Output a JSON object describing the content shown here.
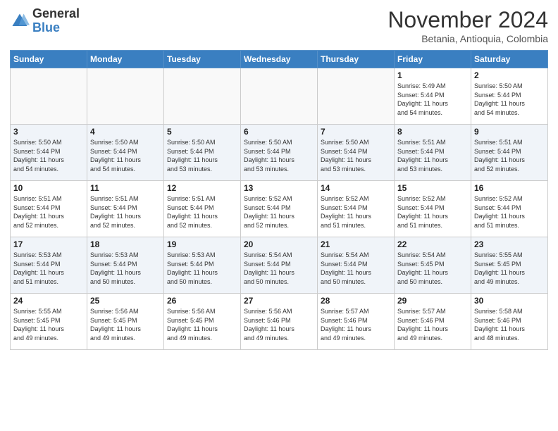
{
  "header": {
    "logo": {
      "general": "General",
      "blue": "Blue"
    },
    "title": "November 2024",
    "location": "Betania, Antioquia, Colombia"
  },
  "days_of_week": [
    "Sunday",
    "Monday",
    "Tuesday",
    "Wednesday",
    "Thursday",
    "Friday",
    "Saturday"
  ],
  "weeks": [
    [
      {
        "day": "",
        "info": ""
      },
      {
        "day": "",
        "info": ""
      },
      {
        "day": "",
        "info": ""
      },
      {
        "day": "",
        "info": ""
      },
      {
        "day": "",
        "info": ""
      },
      {
        "day": "1",
        "info": "Sunrise: 5:49 AM\nSunset: 5:44 PM\nDaylight: 11 hours\nand 54 minutes."
      },
      {
        "day": "2",
        "info": "Sunrise: 5:50 AM\nSunset: 5:44 PM\nDaylight: 11 hours\nand 54 minutes."
      }
    ],
    [
      {
        "day": "3",
        "info": "Sunrise: 5:50 AM\nSunset: 5:44 PM\nDaylight: 11 hours\nand 54 minutes."
      },
      {
        "day": "4",
        "info": "Sunrise: 5:50 AM\nSunset: 5:44 PM\nDaylight: 11 hours\nand 54 minutes."
      },
      {
        "day": "5",
        "info": "Sunrise: 5:50 AM\nSunset: 5:44 PM\nDaylight: 11 hours\nand 53 minutes."
      },
      {
        "day": "6",
        "info": "Sunrise: 5:50 AM\nSunset: 5:44 PM\nDaylight: 11 hours\nand 53 minutes."
      },
      {
        "day": "7",
        "info": "Sunrise: 5:50 AM\nSunset: 5:44 PM\nDaylight: 11 hours\nand 53 minutes."
      },
      {
        "day": "8",
        "info": "Sunrise: 5:51 AM\nSunset: 5:44 PM\nDaylight: 11 hours\nand 53 minutes."
      },
      {
        "day": "9",
        "info": "Sunrise: 5:51 AM\nSunset: 5:44 PM\nDaylight: 11 hours\nand 52 minutes."
      }
    ],
    [
      {
        "day": "10",
        "info": "Sunrise: 5:51 AM\nSunset: 5:44 PM\nDaylight: 11 hours\nand 52 minutes."
      },
      {
        "day": "11",
        "info": "Sunrise: 5:51 AM\nSunset: 5:44 PM\nDaylight: 11 hours\nand 52 minutes."
      },
      {
        "day": "12",
        "info": "Sunrise: 5:51 AM\nSunset: 5:44 PM\nDaylight: 11 hours\nand 52 minutes."
      },
      {
        "day": "13",
        "info": "Sunrise: 5:52 AM\nSunset: 5:44 PM\nDaylight: 11 hours\nand 52 minutes."
      },
      {
        "day": "14",
        "info": "Sunrise: 5:52 AM\nSunset: 5:44 PM\nDaylight: 11 hours\nand 51 minutes."
      },
      {
        "day": "15",
        "info": "Sunrise: 5:52 AM\nSunset: 5:44 PM\nDaylight: 11 hours\nand 51 minutes."
      },
      {
        "day": "16",
        "info": "Sunrise: 5:52 AM\nSunset: 5:44 PM\nDaylight: 11 hours\nand 51 minutes."
      }
    ],
    [
      {
        "day": "17",
        "info": "Sunrise: 5:53 AM\nSunset: 5:44 PM\nDaylight: 11 hours\nand 51 minutes."
      },
      {
        "day": "18",
        "info": "Sunrise: 5:53 AM\nSunset: 5:44 PM\nDaylight: 11 hours\nand 50 minutes."
      },
      {
        "day": "19",
        "info": "Sunrise: 5:53 AM\nSunset: 5:44 PM\nDaylight: 11 hours\nand 50 minutes."
      },
      {
        "day": "20",
        "info": "Sunrise: 5:54 AM\nSunset: 5:44 PM\nDaylight: 11 hours\nand 50 minutes."
      },
      {
        "day": "21",
        "info": "Sunrise: 5:54 AM\nSunset: 5:44 PM\nDaylight: 11 hours\nand 50 minutes."
      },
      {
        "day": "22",
        "info": "Sunrise: 5:54 AM\nSunset: 5:45 PM\nDaylight: 11 hours\nand 50 minutes."
      },
      {
        "day": "23",
        "info": "Sunrise: 5:55 AM\nSunset: 5:45 PM\nDaylight: 11 hours\nand 49 minutes."
      }
    ],
    [
      {
        "day": "24",
        "info": "Sunrise: 5:55 AM\nSunset: 5:45 PM\nDaylight: 11 hours\nand 49 minutes."
      },
      {
        "day": "25",
        "info": "Sunrise: 5:56 AM\nSunset: 5:45 PM\nDaylight: 11 hours\nand 49 minutes."
      },
      {
        "day": "26",
        "info": "Sunrise: 5:56 AM\nSunset: 5:45 PM\nDaylight: 11 hours\nand 49 minutes."
      },
      {
        "day": "27",
        "info": "Sunrise: 5:56 AM\nSunset: 5:46 PM\nDaylight: 11 hours\nand 49 minutes."
      },
      {
        "day": "28",
        "info": "Sunrise: 5:57 AM\nSunset: 5:46 PM\nDaylight: 11 hours\nand 49 minutes."
      },
      {
        "day": "29",
        "info": "Sunrise: 5:57 AM\nSunset: 5:46 PM\nDaylight: 11 hours\nand 49 minutes."
      },
      {
        "day": "30",
        "info": "Sunrise: 5:58 AM\nSunset: 5:46 PM\nDaylight: 11 hours\nand 48 minutes."
      }
    ]
  ]
}
